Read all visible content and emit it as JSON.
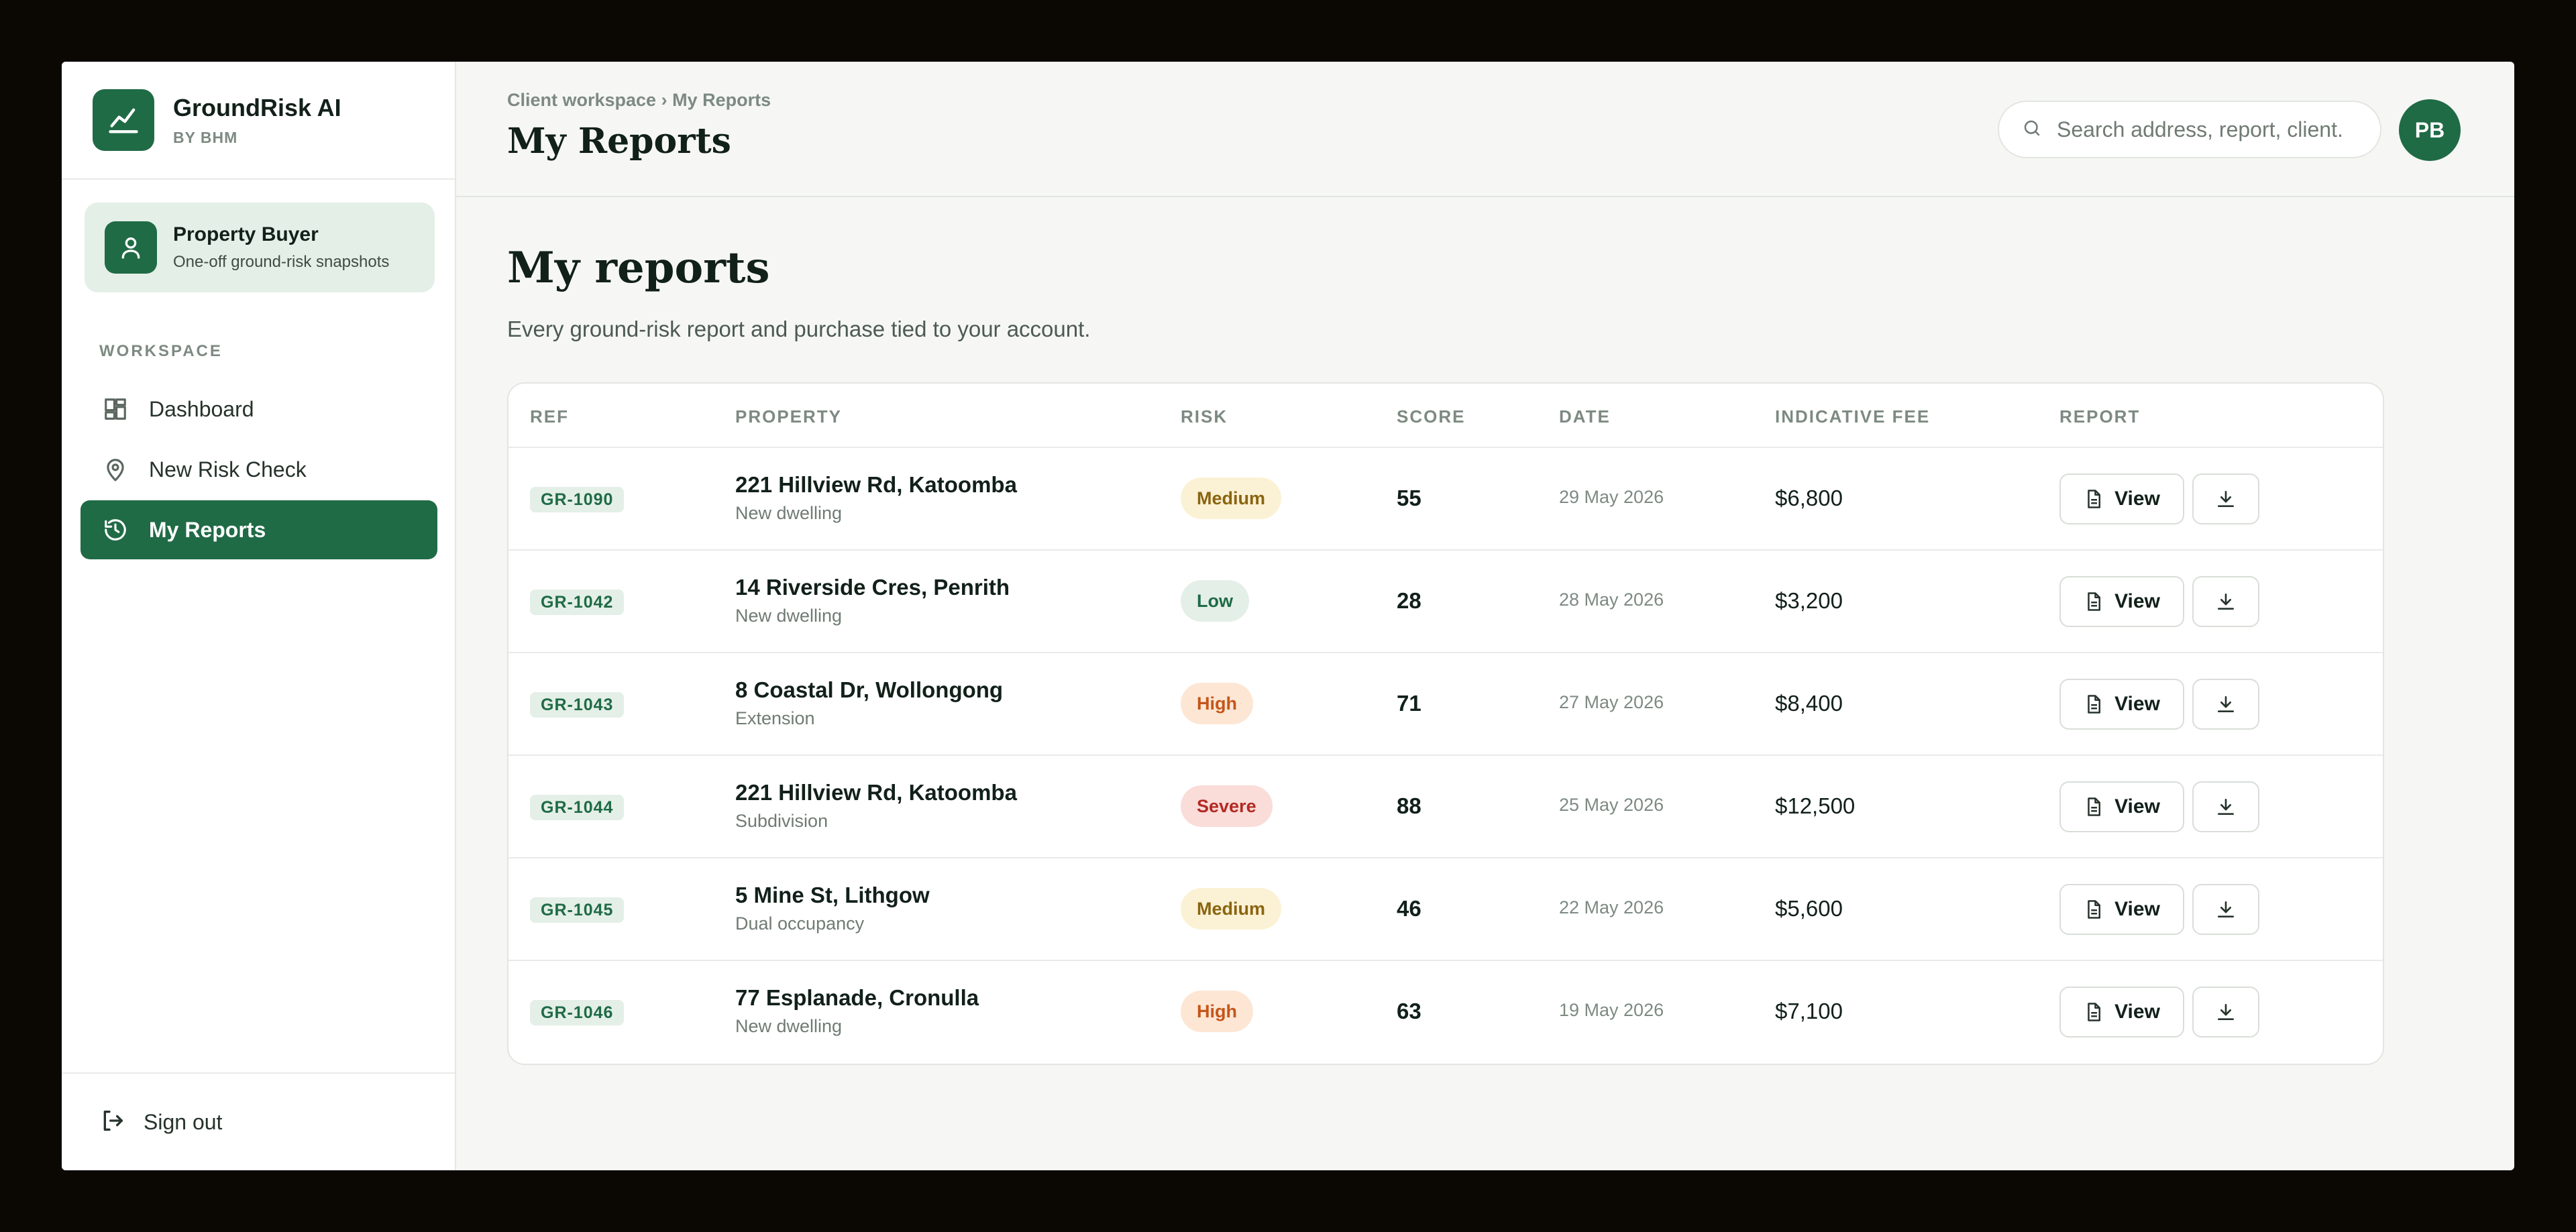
{
  "brand": {
    "name": "GroundRisk AI",
    "sub": "BY BHM"
  },
  "role": {
    "title": "Property Buyer",
    "sub": "One-off ground-risk snapshots"
  },
  "sidebar": {
    "section_label": "WORKSPACE",
    "items": [
      {
        "label": "Dashboard",
        "icon": "dashboard-icon",
        "active": false
      },
      {
        "label": "New Risk Check",
        "icon": "map-pin-icon",
        "active": false
      },
      {
        "label": "My Reports",
        "icon": "history-icon",
        "active": true
      }
    ],
    "signout_label": "Sign out"
  },
  "header": {
    "breadcrumb": "Client workspace › My Reports",
    "title": "My Reports",
    "search_placeholder": "Search address, report, client.",
    "avatar_initials": "PB"
  },
  "content": {
    "title": "My reports",
    "subtitle": "Every ground-risk report and purchase tied to your account."
  },
  "table": {
    "headers": [
      "REF",
      "PROPERTY",
      "RISK",
      "SCORE",
      "DATE",
      "INDICATIVE FEE",
      "REPORT"
    ],
    "view_label": "View",
    "rows": [
      {
        "ref": "GR-1090",
        "property": "221 Hillview Rd, Katoomba",
        "type": "New dwelling",
        "risk": "Medium",
        "score": "55",
        "date": "29 May 2026",
        "fee": "$6,800"
      },
      {
        "ref": "GR-1042",
        "property": "14 Riverside Cres, Penrith",
        "type": "New dwelling",
        "risk": "Low",
        "score": "28",
        "date": "28 May 2026",
        "fee": "$3,200"
      },
      {
        "ref": "GR-1043",
        "property": "8 Coastal Dr, Wollongong",
        "type": "Extension",
        "risk": "High",
        "score": "71",
        "date": "27 May 2026",
        "fee": "$8,400"
      },
      {
        "ref": "GR-1044",
        "property": "221 Hillview Rd, Katoomba",
        "type": "Subdivision",
        "risk": "Severe",
        "score": "88",
        "date": "25 May 2026",
        "fee": "$12,500"
      },
      {
        "ref": "GR-1045",
        "property": "5 Mine St, Lithgow",
        "type": "Dual occupancy",
        "risk": "Medium",
        "score": "46",
        "date": "22 May 2026",
        "fee": "$5,600"
      },
      {
        "ref": "GR-1046",
        "property": "77 Esplanade, Cronulla",
        "type": "New dwelling",
        "risk": "High",
        "score": "63",
        "date": "19 May 2026",
        "fee": "$7,100"
      }
    ]
  },
  "colors": {
    "accent": "#1f6b46",
    "risk_medium": "#8a6410",
    "risk_low": "#1f6b46",
    "risk_high": "#c4561a",
    "risk_severe": "#b32a22"
  }
}
